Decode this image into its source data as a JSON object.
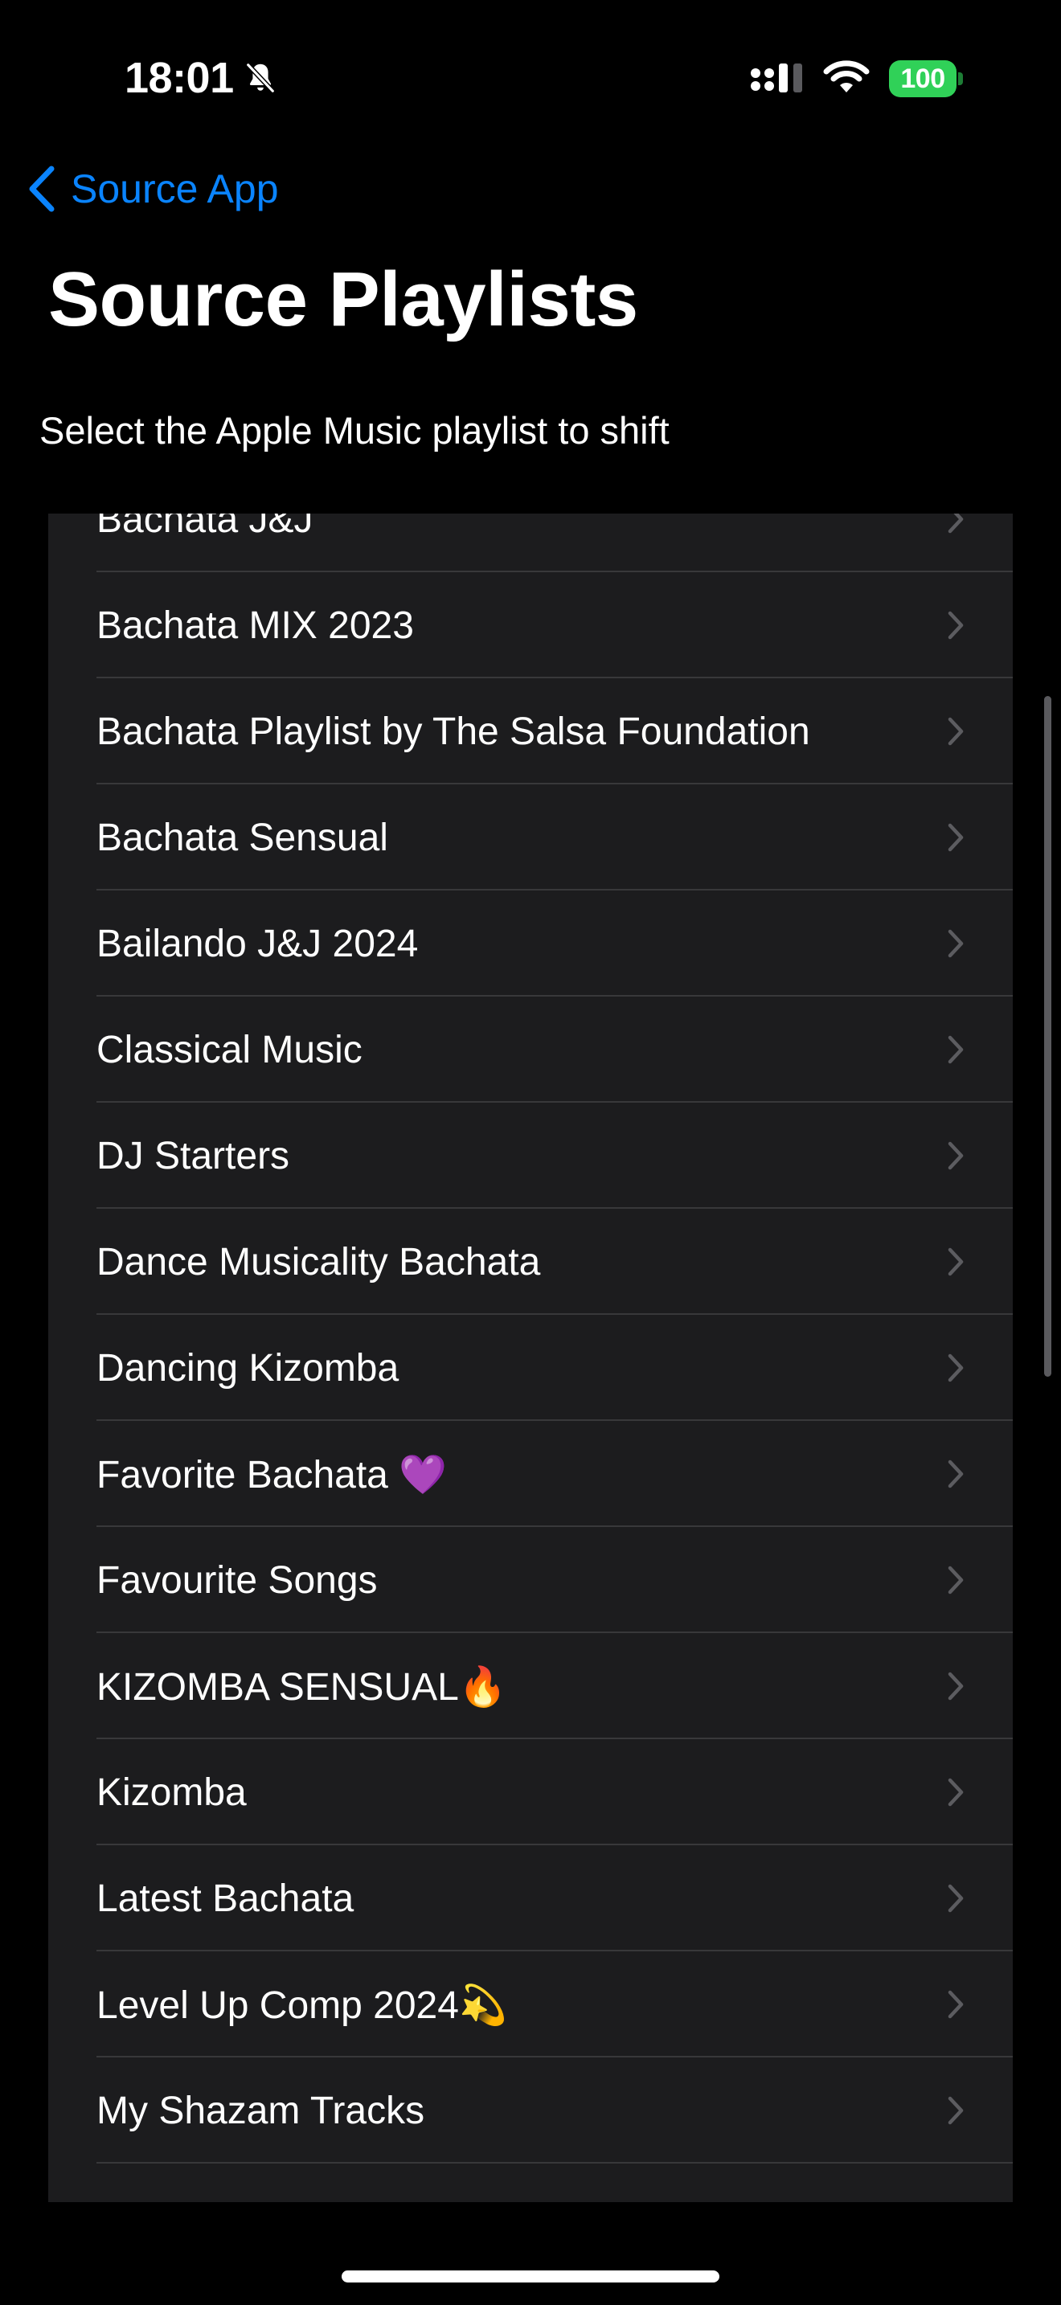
{
  "status_bar": {
    "time": "18:01",
    "battery_level": "100",
    "icons": [
      "bell-slash-icon",
      "cellular-signal-icon",
      "wifi-icon",
      "battery-icon"
    ]
  },
  "nav": {
    "back_label": "Source App",
    "back_icon": "chevron-left-icon"
  },
  "page": {
    "title": "Source Playlists",
    "subtitle": "Select the Apple Music playlist to shift"
  },
  "playlists": [
    {
      "label": "Bachata J&J"
    },
    {
      "label": "Bachata MIX 2023"
    },
    {
      "label": "Bachata Playlist by The Salsa Foundation"
    },
    {
      "label": "Bachata Sensual"
    },
    {
      "label": "Bailando J&J 2024"
    },
    {
      "label": "Classical Music"
    },
    {
      "label": "DJ Starters"
    },
    {
      "label": "Dance Musicality Bachata"
    },
    {
      "label": "Dancing Kizomba"
    },
    {
      "label": "Favorite Bachata 💜"
    },
    {
      "label": "Favourite Songs"
    },
    {
      "label": "KIZOMBA SENSUAL🔥"
    },
    {
      "label": "Kizomba"
    },
    {
      "label": "Latest Bachata"
    },
    {
      "label": "Level Up Comp 2024💫"
    },
    {
      "label": "My Shazam Tracks"
    }
  ],
  "colors": {
    "background": "#000000",
    "row_background": "#1c1c1e",
    "separator": "#38383a",
    "accent": "#0a84ff",
    "battery": "#30d158",
    "chevron": "#5c5c60"
  }
}
